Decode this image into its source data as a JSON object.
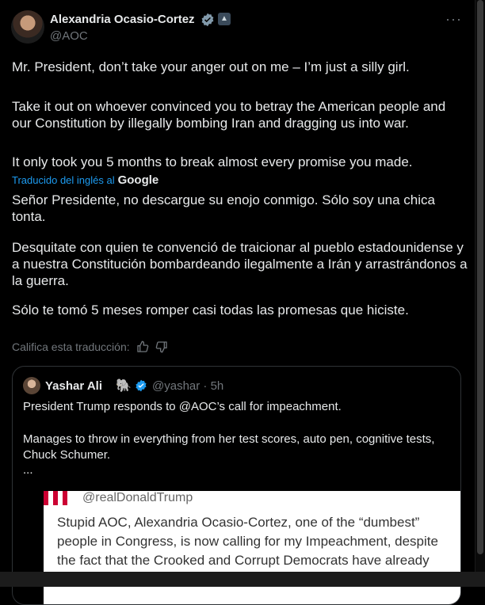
{
  "author": {
    "name": "Alexandria Ocasio-Cortez",
    "handle": "@AOC"
  },
  "more_label": "···",
  "original": [
    "Mr. President, don’t take your anger out on me – I’m just a silly girl.",
    "Take it out on whoever convinced you to betray the American people and our Constitution by illegally bombing Iran and dragging us into war.",
    "It only took you 5 months to break almost every promise you made."
  ],
  "translated_label": "Traducido del inglés al",
  "translated_brand": "Google",
  "translation": [
    "Señor Presidente, no descargue su enojo conmigo. Sólo soy una chica tonta.",
    "Desquitate con quien te convenció de traicionar al pueblo estadounidense y a nuestra Constitución bombardeando ilegalmente a Irán y arrastrándonos a la guerra.",
    "Sólo te tomó 5 meses romper casi todas las promesas que hiciste."
  ],
  "rate_label": "Califica esta traducción:",
  "quote": {
    "name": "Yashar Ali",
    "emoji": "🐘",
    "handle_time": "@yashar · 5h",
    "lines": [
      "President Trump responds to @AOC’s call for impeachment.",
      "Manages to throw in everything from her test scores, auto pen, cognitive tests, Chuck Schumer.",
      "..."
    ],
    "image": {
      "handle": "@realDonaldTrump",
      "text": "Stupid AOC, Alexandria Ocasio-Cortez, one of the “dumbest” people in Congress, is now calling for my Impeachment, despite the fact that the Crooked and Corrupt Democrats have already"
    }
  },
  "colors": {
    "background": "#000000",
    "accent": "#1d9bf0",
    "muted": "#71767b"
  }
}
